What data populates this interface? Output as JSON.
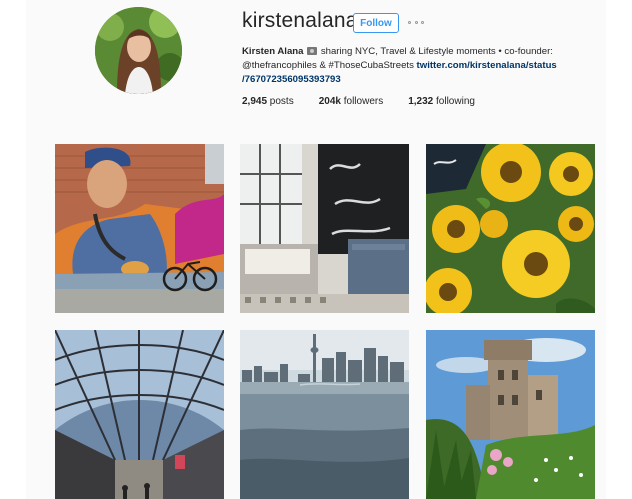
{
  "profile": {
    "username": "kirstenalana",
    "follow_label": "Follow",
    "bio": {
      "name": "Kirsten Alana",
      "text1": " sharing NYC, Travel & Lifestyle moments • co-founder:",
      "mention": "@thefrancophiles",
      "amp": " & ",
      "hashtag": "#ThoseCubaStreets",
      "url_part1": " twitter.com/kirstenalana/status",
      "url_part2": "/767072356095393793"
    },
    "stats": {
      "posts_count": "2,945",
      "posts_label": " posts",
      "followers_count": "204k",
      "followers_label": " followers",
      "following_count": "1,232",
      "following_label": " following"
    }
  },
  "posts": [
    {
      "subject": "street mural"
    },
    {
      "subject": "cafe interior"
    },
    {
      "subject": "sunflowers"
    },
    {
      "subject": "glass arcade"
    },
    {
      "subject": "city skyline"
    },
    {
      "subject": "castle garden"
    }
  ],
  "colors": {
    "accent": "#3897f0",
    "link": "#003569",
    "text": "#262626"
  }
}
